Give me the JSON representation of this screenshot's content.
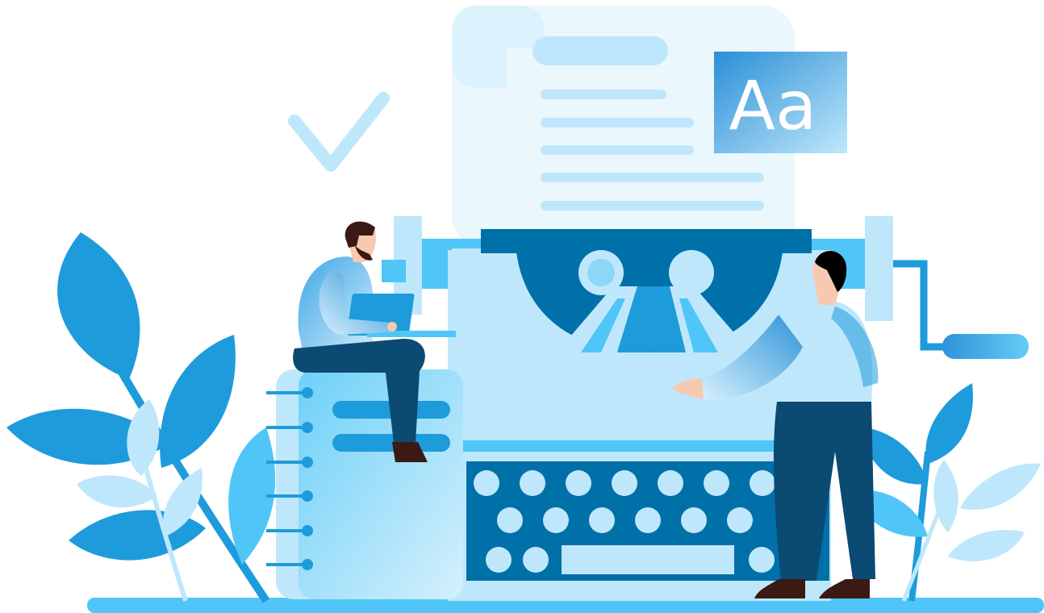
{
  "badge": {
    "text": "Aa"
  },
  "colors": {
    "accent_dark": "#0070A8",
    "accent": "#1E9BDB",
    "accent_light": "#4FC6F7",
    "pale": "#BFE7FB",
    "paper": "#EAF7FD",
    "navy": "#0B4A72",
    "ground": "#4FC6F7"
  }
}
